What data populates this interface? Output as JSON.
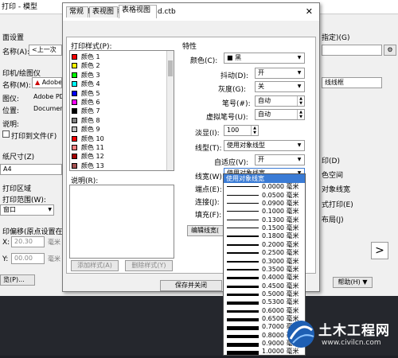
{
  "bg": {
    "title": "打印 - 模型",
    "labels": [
      "面设置",
      "名称(A):",
      "印机/绘图仪",
      "名称(M):",
      "图仪:",
      "位置:",
      "说明:",
      "打印到文件(F)",
      "纸尺寸(Z)",
      "A4",
      "打印区域",
      "打印范围(W):",
      "窗口",
      "印偏移(原点设置在",
      "X:",
      "Y:",
      "览(P)..."
    ],
    "name_value": "<上一次",
    "printer_value": "Adobe PD",
    "plotter_value": "Adobe PD",
    "location_value": "Document",
    "offset_x": "20.30",
    "offset_y": "00.00",
    "x_unit": "毫米",
    "y_unit": "毫米",
    "right_labels": [
      "指定)(G)",
      "线线框",
      "印(D)",
      "色空间",
      "对象线宽",
      "式打印(E)",
      "布局(J)"
    ],
    "help": "帮助(H)",
    "right_arrow": ">"
  },
  "dialog": {
    "title": "打印样式表编辑器 - acad.ctb",
    "tabs": [
      "常规",
      "表视图",
      "表格视图"
    ],
    "styles_label": "打印样式(P):",
    "styles": [
      {
        "label": "颜色 1",
        "color": "#ff0000"
      },
      {
        "label": "颜色 2",
        "color": "#ffff00"
      },
      {
        "label": "颜色 3",
        "color": "#00ff00"
      },
      {
        "label": "颜色 4",
        "color": "#00ffff"
      },
      {
        "label": "颜色 5",
        "color": "#0000ff"
      },
      {
        "label": "颜色 6",
        "color": "#ff00ff"
      },
      {
        "label": "颜色 7",
        "color": "#000000"
      },
      {
        "label": "颜色 8",
        "color": "#808080"
      },
      {
        "label": "颜色 9",
        "color": "#c0c0c0"
      },
      {
        "label": "颜色 10",
        "color": "#ff0000"
      },
      {
        "label": "颜色 11",
        "color": "#ff7f7f"
      },
      {
        "label": "颜色 12",
        "color": "#a50000"
      },
      {
        "label": "颜色 13",
        "color": "#a55252"
      }
    ],
    "description_label": "说明(R):",
    "add_style": "添加样式(A)",
    "delete_style": "删除样式(Y)",
    "properties_label": "特性",
    "props": {
      "color_label": "颜色(C):",
      "color_value": "■ 黑",
      "dither_label": "抖动(D):",
      "dither_value": "开",
      "grayscale_label": "灰度(G):",
      "grayscale_value": "关",
      "pen_label": "笔号(#):",
      "pen_value": "自动",
      "virtual_pen_label": "虚拟笔号(U):",
      "virtual_pen_value": "自动",
      "screening_label": "淡显(I):",
      "screening_value": "100",
      "linetype_label": "线型(T):",
      "linetype_value": "使用对象线型",
      "adaptive_label": "自适应(V):",
      "adaptive_value": "开",
      "lineweight_label": "线宽(W):",
      "lineweight_value": "使用对象线宽",
      "endstyle_label": "端点(E):",
      "joinstyle_label": "连接(J):",
      "fillstyle_label": "填充(F):"
    },
    "edit_lineweight": "编辑线宽(",
    "save_close": "保存并关闭"
  },
  "lineweights": [
    "使用对象线宽",
    "0.0000 毫米",
    "0.0500 毫米",
    "0.0900 毫米",
    "0.1000 毫米",
    "0.1300 毫米",
    "0.1500 毫米",
    "0.1800 毫米",
    "0.2000 毫米",
    "0.2500 毫米",
    "0.3000 毫米",
    "0.3500 毫米",
    "0.4000 毫米",
    "0.4500 毫米",
    "0.5000 毫米",
    "0.5300 毫米",
    "0.6000 毫米",
    "0.6500 毫米",
    "0.7000 毫米",
    "0.8000 毫米",
    "0.9000 毫米",
    "1.0000 毫米"
  ],
  "watermark": {
    "title": "土木工程网",
    "url": "www.civilcn.com"
  }
}
